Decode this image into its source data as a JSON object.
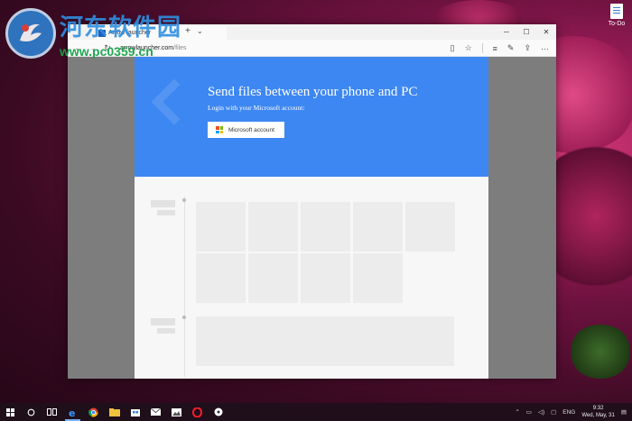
{
  "watermark": {
    "chinese_text": "河东软件园",
    "url": "www.pc0359.cn"
  },
  "desktop": {
    "icon_label": "To-Do",
    "icon": "document-icon"
  },
  "browser": {
    "tab_title": "Arrow launcher",
    "tab_favicon": "arrow-launcher-icon",
    "new_tab_label": "+",
    "tab_list_label": "⌄",
    "window_controls": [
      "─",
      "☐",
      "✕"
    ],
    "url_host": "arrowlauncher.com",
    "url_path": "/files",
    "nav": {
      "back": "←",
      "forward": "→",
      "refresh": "↻"
    },
    "toolbar_icons": [
      "reading-view-icon",
      "favorite-star-icon",
      "hub-icon",
      "web-note-icon",
      "share-icon",
      "more-icon"
    ]
  },
  "hero": {
    "title": "Send files between your phone and PC",
    "subtitle": "Login with your Microsoft account:",
    "button_label": "Microsoft account",
    "background_color": "#3d87f2"
  },
  "taskbar": {
    "pinned_icons": [
      "start-icon",
      "search-icon",
      "task-view-icon",
      "edge-icon",
      "chrome-icon",
      "file-explorer-icon",
      "store-icon",
      "mail-icon",
      "photos-icon",
      "opera-icon",
      "groove-icon"
    ],
    "tray_icons": [
      "chevron-up-icon",
      "network-icon",
      "volume-icon",
      "messages-icon"
    ],
    "language": "ENG",
    "time": "9:32",
    "date": "Wed, May, 31"
  }
}
